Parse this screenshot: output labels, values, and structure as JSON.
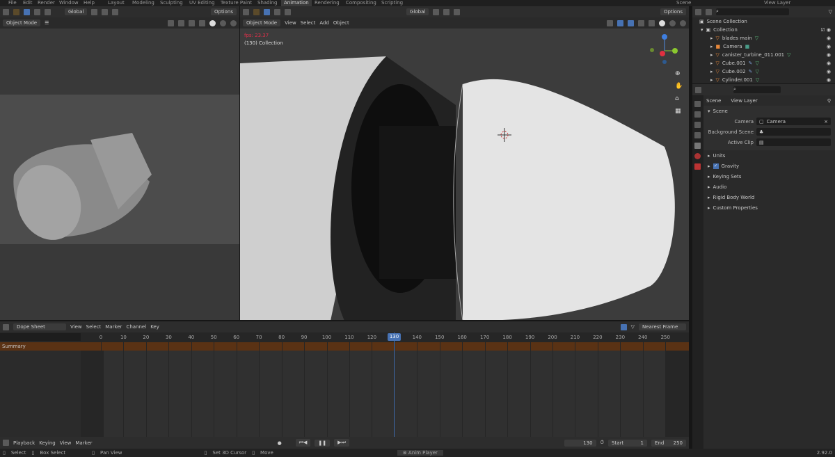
{
  "menu": [
    "File",
    "Edit",
    "Render",
    "Window",
    "Help"
  ],
  "workspaces": [
    "Layout",
    "Modeling",
    "Sculpting",
    "UV Editing",
    "Texture Paint",
    "Shading",
    "Animation",
    "Rendering",
    "Compositing",
    "Scripting"
  ],
  "active_workspace": "Animation",
  "scene": "Scene",
  "view_layer": "View Layer",
  "left_view": {
    "orientation": "Global",
    "options": "Options",
    "mode": "Object Mode"
  },
  "main_view": {
    "orientation": "Global",
    "options": "Options",
    "mode": "Object Mode",
    "menus": [
      "View",
      "Select",
      "Add",
      "Object"
    ],
    "fps": "fps: 23.37",
    "collection_label": "(130) Collection"
  },
  "outliner": {
    "root": "Scene Collection",
    "collection": "Collection",
    "items": [
      "blades main",
      "Camera",
      "canister_turbine_011.001",
      "Cube.001",
      "Cube.002",
      "Cylinder.001"
    ]
  },
  "properties": {
    "tabs": [
      "Scene",
      "View Layer"
    ],
    "panel": "Scene",
    "fields": [
      {
        "label": "Camera",
        "value": "Camera"
      },
      {
        "label": "Background Scene",
        "value": ""
      },
      {
        "label": "Active Clip",
        "value": ""
      }
    ],
    "sections": [
      "Units",
      "Gravity",
      "Keying Sets",
      "Audio",
      "Rigid Body World",
      "Custom Properties"
    ],
    "gravity_checked": true
  },
  "dope": {
    "editor": "Dope Sheet",
    "menus": [
      "View",
      "Select",
      "Marker",
      "Channel",
      "Key"
    ],
    "snap": "Nearest Frame",
    "ticks": [
      "0",
      "10",
      "20",
      "30",
      "40",
      "50",
      "60",
      "70",
      "80",
      "90",
      "100",
      "110",
      "120",
      "130",
      "140",
      "150",
      "160",
      "170",
      "180",
      "190",
      "200",
      "210",
      "220",
      "230",
      "240",
      "250"
    ],
    "current_frame": "130",
    "summary": "Summary"
  },
  "footer": {
    "menus": [
      "Playback",
      "Keying",
      "View",
      "Marker"
    ],
    "frame": "130",
    "start_label": "Start",
    "start": "1",
    "end_label": "End",
    "end": "250"
  },
  "status": {
    "items": [
      "Select",
      "Box Select",
      "Pan View",
      "Set 3D Cursor",
      "Move"
    ],
    "anim_player": "Anim Player",
    "version": "2.92.0"
  },
  "colors": {
    "accent": "#4772b3",
    "summary": "#5a3214",
    "playhead": "#4772b3",
    "fps": "#e0304a"
  }
}
